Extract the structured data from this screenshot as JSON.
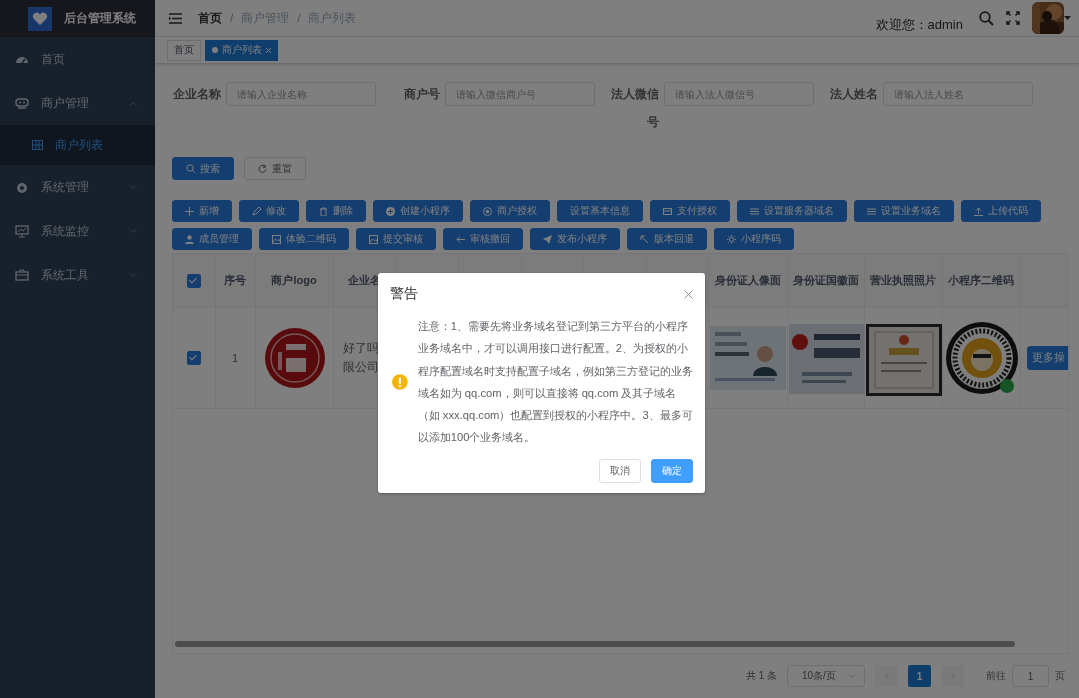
{
  "app": {
    "title": "后台管理系统"
  },
  "sidebar": {
    "items": [
      {
        "label": "首页",
        "kind": "link",
        "selected": false
      },
      {
        "label": "商户管理",
        "kind": "submenu",
        "expanded": true,
        "children": [
          {
            "label": "商户列表",
            "selected": true
          }
        ]
      },
      {
        "label": "系统管理",
        "kind": "submenu",
        "expanded": false
      },
      {
        "label": "系统监控",
        "kind": "submenu",
        "expanded": false
      },
      {
        "label": "系统工具",
        "kind": "submenu",
        "expanded": false
      }
    ]
  },
  "header": {
    "breadcrumb": [
      {
        "label": "首页"
      },
      {
        "separator": "/",
        "label": "商户管理"
      },
      {
        "separator": "/",
        "label": "商户列表"
      }
    ],
    "welcome": "欢迎您：admin"
  },
  "tags": [
    {
      "label": "首页",
      "selected": false
    },
    {
      "label": "商户列表",
      "selected": true
    }
  ],
  "filters": [
    {
      "label": "企业名称",
      "placeholder": "请输入企业名称"
    },
    {
      "label": "商户号",
      "placeholder": "请输入微信商户号"
    },
    {
      "label": "法人微信号",
      "placeholder": "请输入法人微信号"
    },
    {
      "label": "法人姓名",
      "placeholder": "请输入法人姓名"
    }
  ],
  "search_buttons": [
    {
      "label": "搜索",
      "kind": "primary"
    },
    {
      "label": "重置",
      "kind": "plain"
    }
  ],
  "action_rows": [
    {
      "buttons": [
        "新增",
        "修改",
        "删除",
        "创建小程序",
        "商户授权",
        "设置基本信息",
        "支付授权",
        "设置服务器域名",
        "设置业务域名",
        "上传代码"
      ]
    },
    {
      "buttons": [
        "成员管理",
        "体验二维码",
        "提交审核",
        "审核撤回",
        "发布小程序",
        "版本回退",
        "小程序码"
      ]
    }
  ],
  "table": {
    "columns": [
      {
        "kind": "check",
        "checked": true
      },
      {
        "kind": "text",
        "label": "序号"
      },
      {
        "kind": "text",
        "label": "商户logo"
      },
      {
        "kind": "text",
        "label": "企业名"
      },
      {
        "kind": "blank"
      },
      {
        "kind": "blank"
      },
      {
        "kind": "blank"
      },
      {
        "kind": "blank"
      },
      {
        "kind": "blank"
      },
      {
        "kind": "text",
        "label": "身份证人像面"
      },
      {
        "kind": "text",
        "label": "身份证国徽面"
      },
      {
        "kind": "text",
        "label": "营业执照照片"
      },
      {
        "kind": "text",
        "label": "小程序二维码"
      },
      {
        "kind": "blank"
      }
    ],
    "rows": [
      {
        "cells": [
          {
            "kind": "check",
            "checked": true
          },
          {
            "kind": "text",
            "text": "1"
          },
          {
            "kind": "picture"
          },
          {
            "kind": "lines",
            "lines": [
              "好了吗",
              "限公司"
            ]
          },
          {
            "kind": "blank"
          },
          {
            "kind": "blank"
          },
          {
            "kind": "blank"
          },
          {
            "kind": "blank"
          },
          {
            "kind": "blank"
          },
          {
            "kind": "picture"
          },
          {
            "kind": "picture"
          },
          {
            "kind": "picture"
          },
          {
            "kind": "picture"
          },
          {
            "kind": "button",
            "text": "更多操"
          }
        ]
      }
    ]
  },
  "pagination": {
    "total": "共 1 条",
    "page_size": "10条/页",
    "pages": [
      {
        "label": "1",
        "selected": true
      }
    ],
    "goto_label": "前往",
    "goto_value": "1",
    "goto_suffix": "页"
  },
  "dialog": {
    "title": "警告",
    "message": "注意：1、需要先将业务域名登记到第三方平台的小程序业务域名中，才可以调用接口进行配置。2、为授权的小程序配置域名时支持配置子域名，例如第三方登记的业务域名如为 qq.com，则可以直接将 qq.com 及其子域名（如 xxx.qq.com）也配置到授权的小程序中。3、最多可以添加100个业务域名。",
    "buttons": [
      {
        "label": "取消",
        "kind": "plain"
      },
      {
        "label": "确定",
        "kind": "primary"
      }
    ]
  }
}
